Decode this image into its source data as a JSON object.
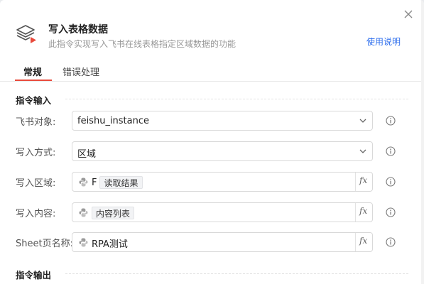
{
  "header": {
    "title": "写入表格数据",
    "subtitle": "此指令实现写入飞书在线表格指定区域数据的功能",
    "help_link": "使用说明"
  },
  "tabs": [
    {
      "label": "常规",
      "active": true
    },
    {
      "label": "错误处理",
      "active": false
    }
  ],
  "sections": {
    "input_title": "指令输入",
    "output_title": "指令输出"
  },
  "fields": {
    "feishu_object": {
      "label": "飞书对象:",
      "value": "feishu_instance"
    },
    "write_mode": {
      "label": "写入方式:",
      "value": "区域"
    },
    "write_range": {
      "label": "写入区域:",
      "prefix": "F",
      "tag": "读取结果"
    },
    "write_content": {
      "label": "写入内容:",
      "tag": "内容列表"
    },
    "sheet_name": {
      "label": "Sheet页名称:",
      "value": "RPA测试"
    }
  },
  "fx_label": "fx",
  "icons": {
    "close": "close-icon",
    "header": "layers-icon",
    "dropdown": "chevron-down-icon",
    "python": "python-icon",
    "info": "info-icon"
  },
  "colors": {
    "accent_red": "#e84a3c",
    "link_blue": "#2f6fed"
  }
}
